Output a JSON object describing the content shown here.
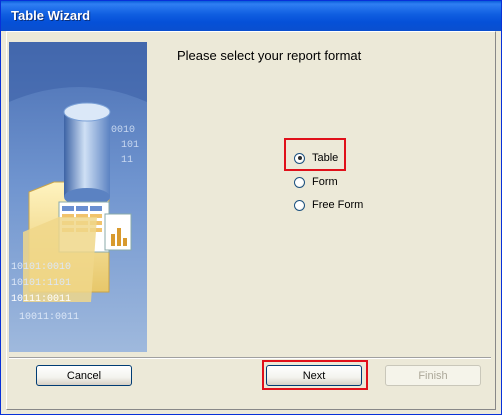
{
  "window": {
    "title": "Table Wizard"
  },
  "wizard": {
    "heading": "Please select your report format",
    "options": [
      {
        "label": "Table",
        "checked": true
      },
      {
        "label": "Form",
        "checked": false
      },
      {
        "label": "Free Form",
        "checked": false
      }
    ],
    "illustration_binary": [
      "0101:0010",
      "101",
      "11",
      "10101:0010",
      "10101:1101",
      "10111:0011",
      "10011:0011"
    ]
  },
  "buttons": {
    "cancel": "Cancel",
    "next": "Next",
    "finish": "Finish"
  },
  "colors": {
    "titlebar": "#0a5fd8",
    "highlight": "#e0101a",
    "panel_blue": "#5f86c4"
  }
}
